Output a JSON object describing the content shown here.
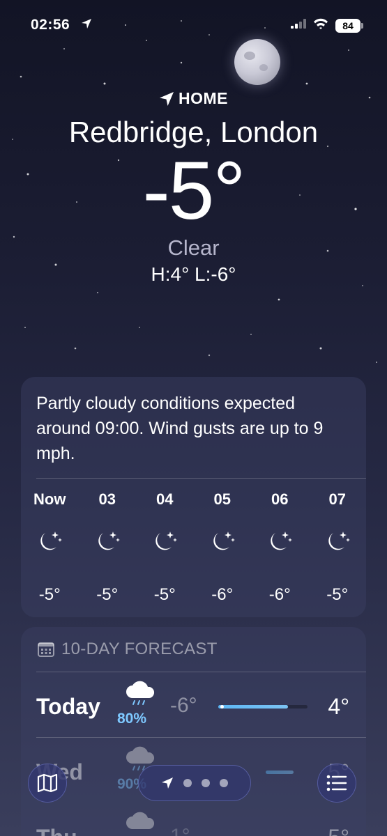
{
  "status_bar": {
    "time": "02:56",
    "battery": "84"
  },
  "header": {
    "home_label": "HOME",
    "location": "Redbridge, London",
    "temperature": "-5°",
    "condition": "Clear",
    "hi_lo": "H:4°  L:-6°"
  },
  "hourly": {
    "summary": "Partly cloudy conditions expected around 09:00. Wind gusts are up to 9 mph.",
    "hours": [
      {
        "label": "Now",
        "icon": "moon-stars-icon",
        "temp": "-5°"
      },
      {
        "label": "03",
        "icon": "moon-stars-icon",
        "temp": "-5°"
      },
      {
        "label": "04",
        "icon": "moon-stars-icon",
        "temp": "-5°"
      },
      {
        "label": "05",
        "icon": "moon-stars-icon",
        "temp": "-6°"
      },
      {
        "label": "06",
        "icon": "moon-stars-icon",
        "temp": "-6°"
      },
      {
        "label": "07",
        "icon": "moon-stars-icon",
        "temp": "-5°"
      }
    ]
  },
  "forecast": {
    "title": "10-DAY FORECAST",
    "days": [
      {
        "day": "Today",
        "icon": "cloud-rain-icon",
        "precip": "80%",
        "low": "-6°",
        "high": "4°"
      },
      {
        "day": "Wed",
        "icon": "cloud-rain-icon",
        "precip": "90%",
        "low": "",
        "high": "5°"
      },
      {
        "day": "Thu",
        "icon": "cloud-rain-icon",
        "precip": "",
        "low": "1°",
        "high": "5°"
      }
    ]
  },
  "colors": {
    "accent": "#5cb6f5",
    "precip": "#7ec8ff",
    "background_top": "#121425",
    "background_bottom": "#3a3e5c"
  }
}
